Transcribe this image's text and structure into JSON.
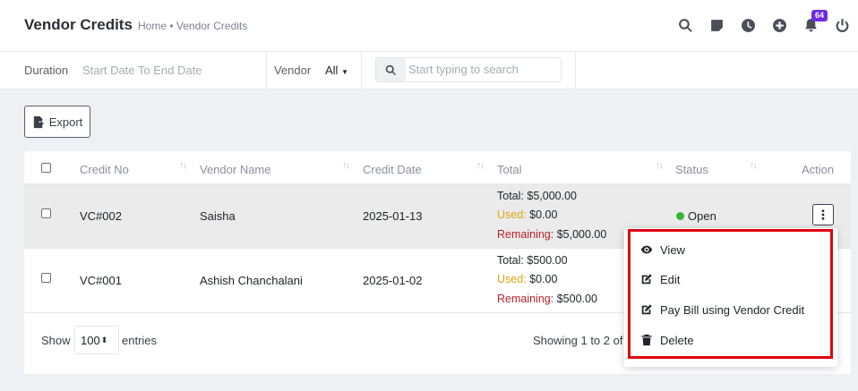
{
  "header": {
    "title": "Vendor Credits",
    "breadcrumb": "Home • Vendor Credits",
    "notification_count": "64",
    "icons": [
      "search-icon",
      "sticky-note-icon",
      "clock-icon",
      "plus-circle-icon",
      "bell-icon",
      "power-icon"
    ]
  },
  "filters": {
    "duration_label": "Duration",
    "date_placeholder": "Start Date To End Date",
    "vendor_label": "Vendor",
    "vendor_value": "All",
    "search_placeholder": "Start typing to search"
  },
  "toolbar": {
    "export_label": "Export"
  },
  "table": {
    "columns": [
      "Credit No",
      "Vendor Name",
      "Credit Date",
      "Total",
      "Status",
      "Action"
    ],
    "rows": [
      {
        "credit_no": "VC#002",
        "vendor": "Saisha",
        "date": "2025-01-13",
        "total_label": "Total:",
        "total": "$5,000.00",
        "used_label": "Used:",
        "used": "$0.00",
        "remaining_label": "Remaining:",
        "remaining": "$5,000.00",
        "status": "Open"
      },
      {
        "credit_no": "VC#001",
        "vendor": "Ashish Chanchalani",
        "date": "2025-01-02",
        "total_label": "Total:",
        "total": "$500.00",
        "used_label": "Used:",
        "used": "$0.00",
        "remaining_label": "Remaining:",
        "remaining": "$500.00",
        "status": ""
      }
    ]
  },
  "footer": {
    "show_label": "Show",
    "page_length": "100",
    "entries_label": "entries",
    "info": "Showing 1 to 2 of"
  },
  "action_menu": {
    "items": [
      {
        "label": "View",
        "icon": "eye-icon"
      },
      {
        "label": "Edit",
        "icon": "edit-icon"
      },
      {
        "label": "Pay Bill using Vendor Credit",
        "icon": "edit-icon"
      },
      {
        "label": "Delete",
        "icon": "trash-icon"
      }
    ]
  },
  "colors": {
    "accent_badge": "#6f2ce3",
    "used": "#e0a413",
    "remaining": "#b8232b",
    "status_open": "#3ab53a",
    "highlight": "#e3000f"
  }
}
